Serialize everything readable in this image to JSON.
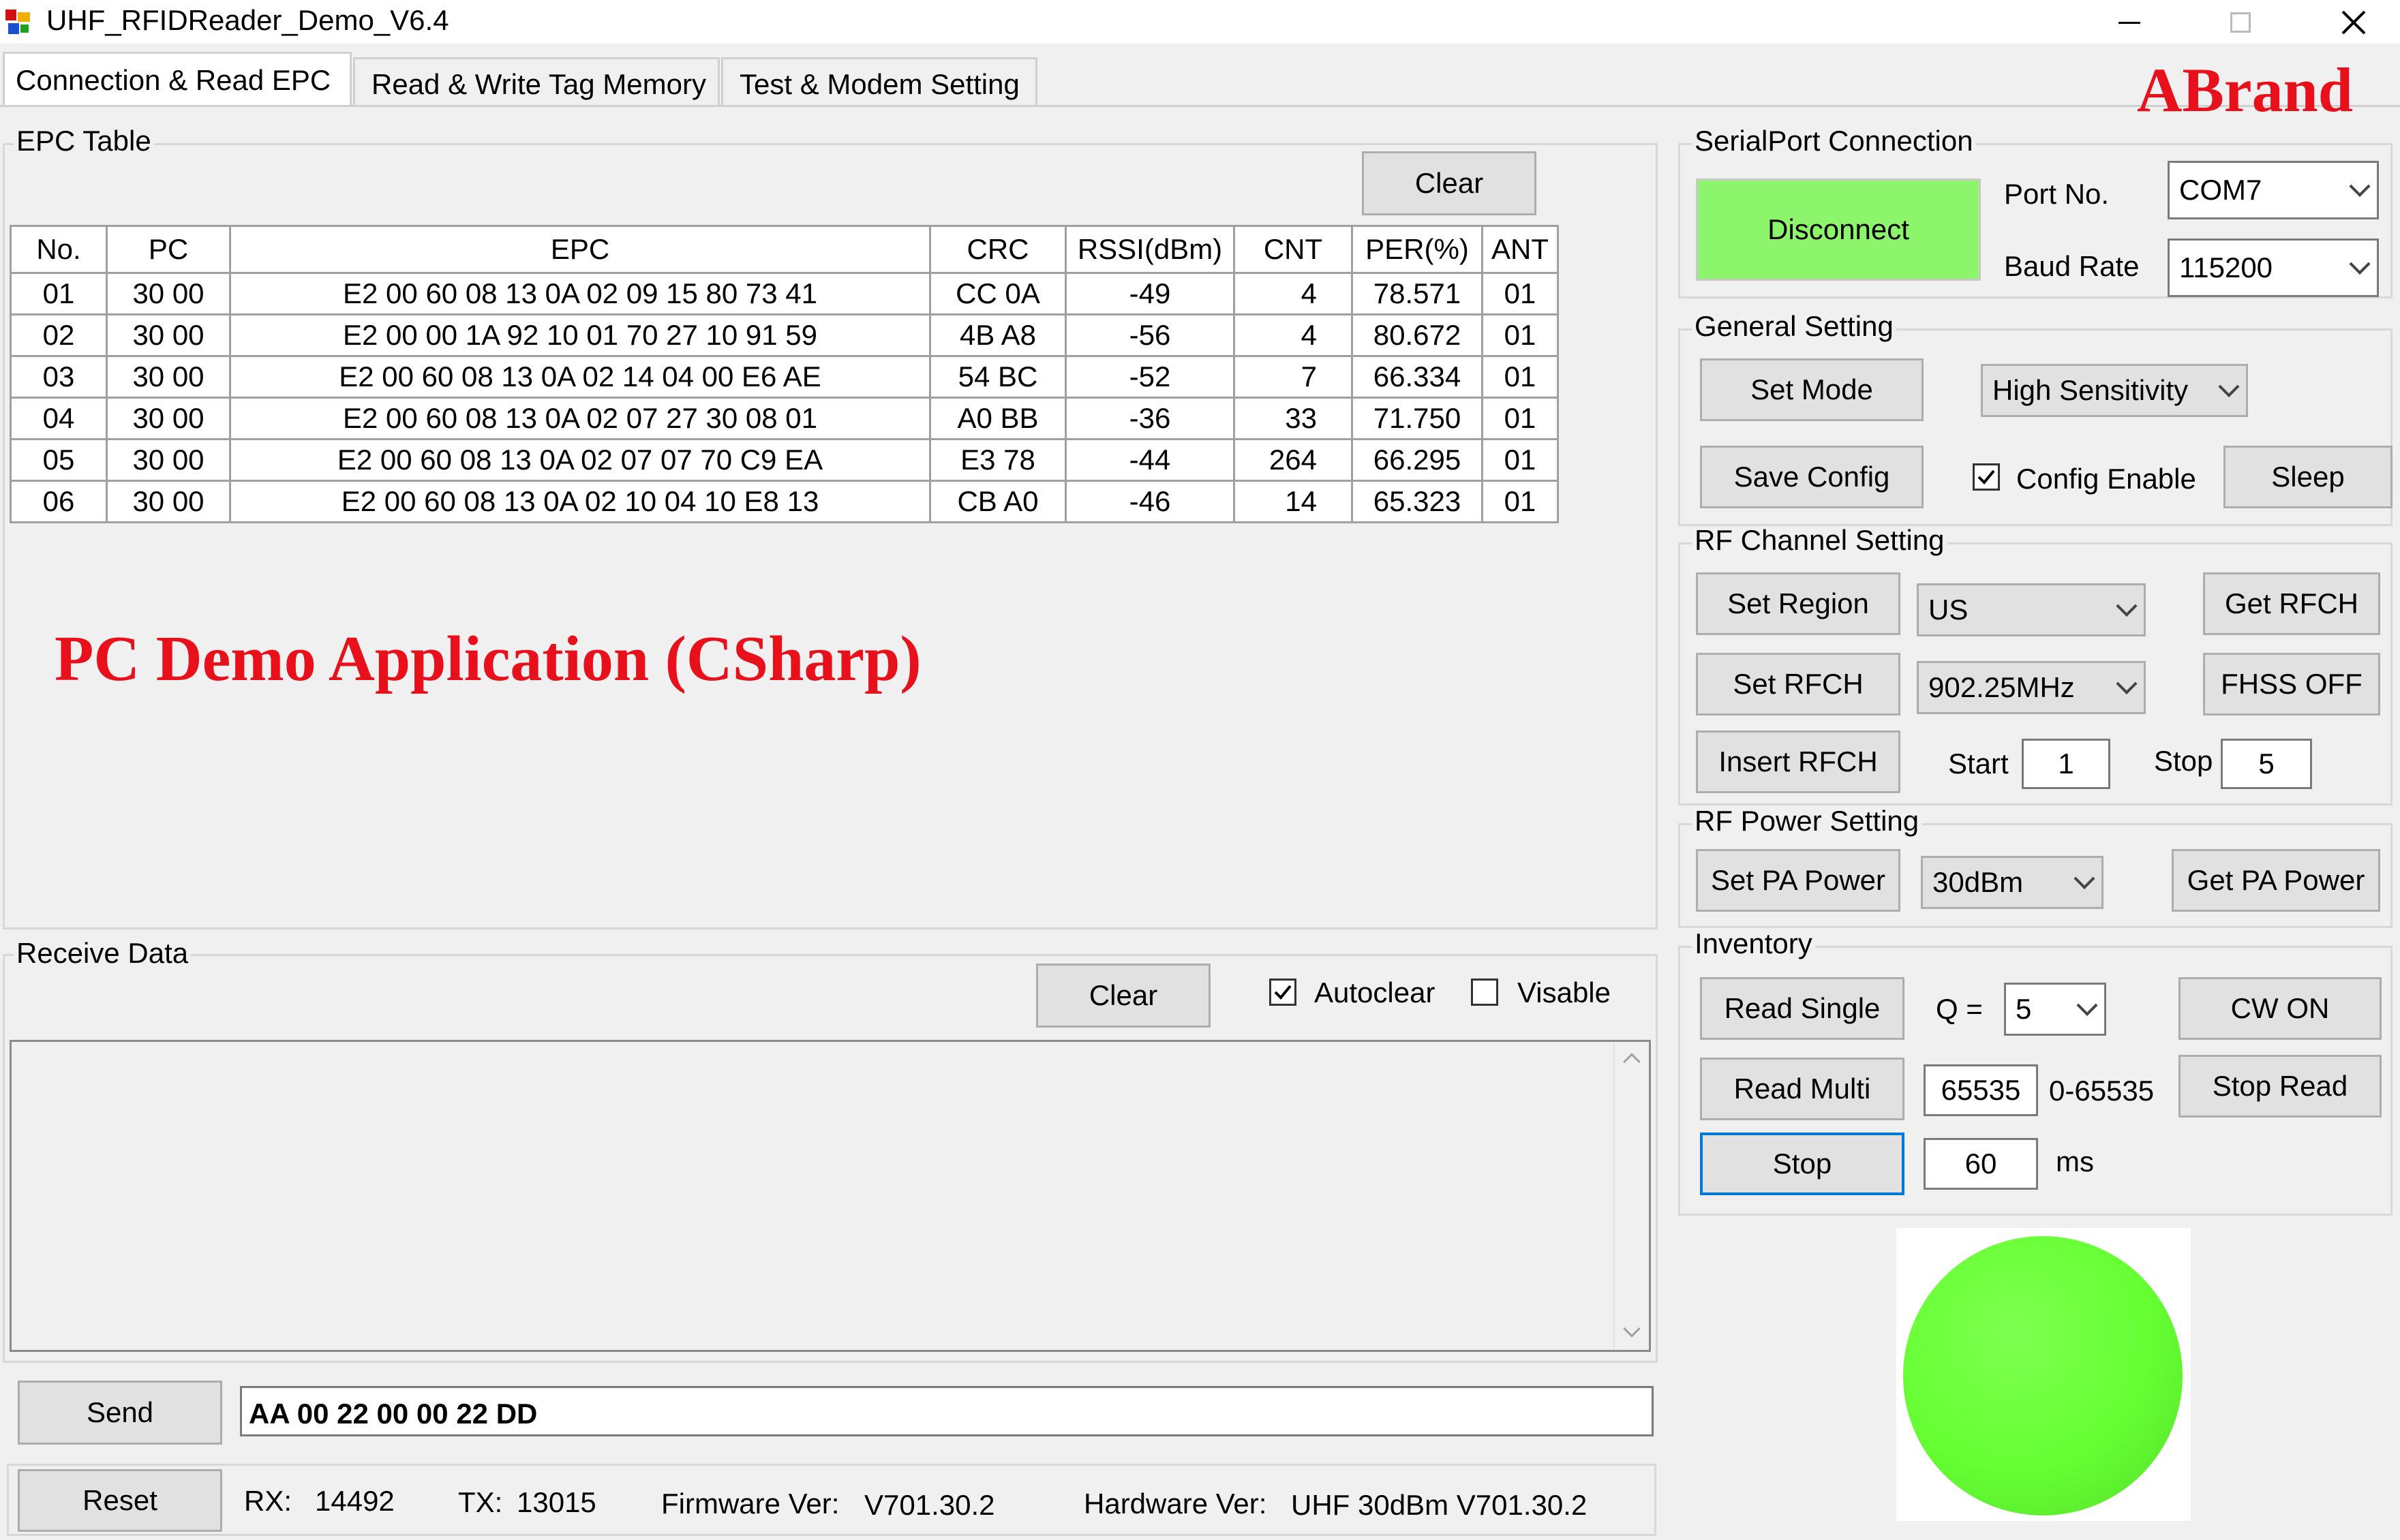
{
  "window": {
    "title": "UHF_RFIDReader_Demo_V6.4",
    "brand": "ABrand"
  },
  "tabs": [
    {
      "label": "Connection & Read EPC"
    },
    {
      "label": "Read & Write Tag Memory"
    },
    {
      "label": "Test & Modem Setting"
    }
  ],
  "epc": {
    "group_label": "EPC Table",
    "clear_label": "Clear",
    "columns": [
      "No.",
      "PC",
      "EPC",
      "CRC",
      "RSSI(dBm)",
      "CNT",
      "PER(%)",
      "ANT"
    ],
    "rows": [
      [
        "01",
        "30 00",
        "E2 00 60 08 13 0A 02 09 15 80 73 41",
        "CC 0A",
        "-49",
        "4",
        "78.571",
        "01"
      ],
      [
        "02",
        "30 00",
        "E2 00 00 1A 92 10 01 70 27 10 91 59",
        "4B A8",
        "-56",
        "4",
        "80.672",
        "01"
      ],
      [
        "03",
        "30 00",
        "E2 00 60 08 13 0A 02 14 04 00 E6 AE",
        "54 BC",
        "-52",
        "7",
        "66.334",
        "01"
      ],
      [
        "04",
        "30 00",
        "E2 00 60 08 13 0A 02 07 27 30 08 01",
        "A0 BB",
        "-36",
        "33",
        "71.750",
        "01"
      ],
      [
        "05",
        "30 00",
        "E2 00 60 08 13 0A 02 07 07 70 C9 EA",
        "E3 78",
        "-44",
        "264",
        "66.295",
        "01"
      ],
      [
        "06",
        "30 00",
        "E2 00 60 08 13 0A 02 10 04 10 E8 13",
        "CB A0",
        "-46",
        "14",
        "65.323",
        "01"
      ]
    ]
  },
  "overlay_caption": "PC Demo Application (CSharp)",
  "receive": {
    "group_label": "Receive Data",
    "clear_label": "Clear",
    "autoclear_label": "Autoclear",
    "autoclear_checked": true,
    "visable_label": "Visable",
    "visable_checked": false,
    "content": ""
  },
  "send": {
    "button_label": "Send",
    "value": "AA 00 22 00 00 22 DD"
  },
  "status": {
    "reset_label": "Reset",
    "rx_label": "RX:",
    "rx_value": "14492",
    "tx_label": "TX:",
    "tx_value": "13015",
    "firmware_label": "Firmware Ver:",
    "firmware_value": "V701.30.2",
    "hardware_label": "Hardware Ver:",
    "hardware_value": "UHF 30dBm V701.30.2"
  },
  "serial": {
    "group_label": "SerialPort Connection",
    "disconnect_label": "Disconnect",
    "port_label": "Port No.",
    "port_value": "COM7",
    "baud_label": "Baud Rate",
    "baud_value": "115200"
  },
  "general": {
    "group_label": "General Setting",
    "set_mode_label": "Set Mode",
    "mode_value": "High Sensitivity",
    "save_config_label": "Save Config",
    "config_enable_label": "Config Enable",
    "config_enable_checked": true,
    "sleep_label": "Sleep"
  },
  "rf_channel": {
    "group_label": "RF Channel Setting",
    "set_region_label": "Set Region",
    "region_value": "US",
    "get_rfch_label": "Get RFCH",
    "set_rfch_label": "Set RFCH",
    "rfch_value": "902.25MHz",
    "fhss_label": "FHSS OFF",
    "insert_rfch_label": "Insert RFCH",
    "start_label": "Start",
    "start_value": "1",
    "stop_label": "Stop",
    "stop_value": "5"
  },
  "rf_power": {
    "group_label": "RF Power Setting",
    "set_pa_label": "Set PA Power",
    "pa_value": "30dBm",
    "get_pa_label": "Get PA Power"
  },
  "inventory": {
    "group_label": "Inventory",
    "read_single_label": "Read Single",
    "q_label": "Q =",
    "q_value": "5",
    "cw_on_label": "CW ON",
    "read_multi_label": "Read Multi",
    "multi_value": "65535",
    "multi_range": "0-65535",
    "stop_read_label": "Stop Read",
    "stop_label": "Stop",
    "interval_value": "60",
    "interval_unit": "ms"
  },
  "colors": {
    "indicator": "#66ff33",
    "disconnect_bg": "#8cf56c",
    "brand": "#e8101a",
    "caption": "#e8101a"
  }
}
